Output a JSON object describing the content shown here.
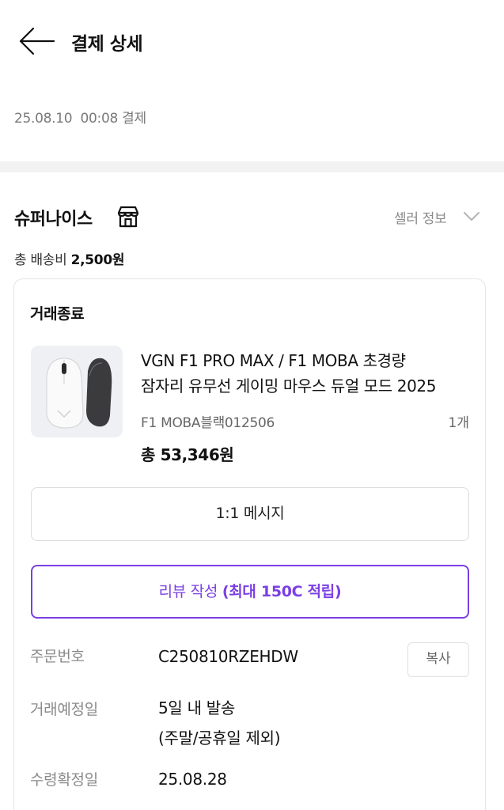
{
  "header": {
    "title": "결제 상세",
    "back_icon": "arrow-left-icon"
  },
  "payment": {
    "paid_at": "25.08.10  00:08 결제"
  },
  "seller": {
    "name": "슈퍼나이스",
    "shop_icon": "store-icon",
    "info_label": "셀러 정보",
    "info_icon": "chevron-down-icon",
    "shipping_label": "총 배송비",
    "shipping_amount": "2,500원"
  },
  "order": {
    "status": "거래종료",
    "product": {
      "title_line1": "VGN F1 PRO MAX / F1 MOBA 초경량",
      "title_line2": "잠자리 유무선 게이밍 마우스  듀얼 모드 2025",
      "option": "F1 MOBA블랙012506",
      "quantity": "1개",
      "total": "총 53,346원"
    },
    "message_button": "1:1 메시지",
    "review_button": {
      "label": "리뷰 작성",
      "bonus": "(최대 150C 적립)"
    },
    "details": {
      "order_number_label": "주문번호",
      "order_number": "C250810RZEHDW",
      "copy_button": "복사",
      "expected_label": "거래예정일",
      "expected_line1": "5일 내 발송",
      "expected_line2": "(주말/공휴일 제외)",
      "confirm_label": "수령확정일",
      "confirm_date": "25.08.28"
    }
  },
  "colors": {
    "accent": "#7b3fe4",
    "divider": "#f2f2f2",
    "muted_text": "#8a8a8a"
  }
}
